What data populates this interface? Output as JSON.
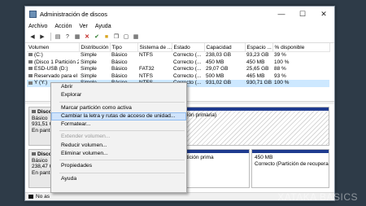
{
  "window": {
    "title": "Administración de discos",
    "min": "—",
    "max": "☐",
    "close": "✕"
  },
  "menu": [
    "Archivo",
    "Acción",
    "Ver",
    "Ayuda"
  ],
  "toolbar_icons": [
    "back-arrow-icon",
    "forward-arrow-icon",
    "list-view-icon",
    "help-icon",
    "properties-icon",
    "delete-icon",
    "check-icon",
    "folder-icon",
    "copy-icon",
    "new-icon",
    "grid-view-icon"
  ],
  "table": {
    "headers": [
      "Volumen",
      "Distribución",
      "Tipo",
      "Sistema de ...",
      "Estado",
      "Capacidad",
      "Espacio ...",
      "% disponible"
    ],
    "rows": [
      [
        "(C:)",
        "Simple",
        "Básico",
        "NTFS",
        "Correcto (...",
        "238,03 GB",
        "93,23 GB",
        "39 %"
      ],
      [
        "(Disco 1 Partición 2)",
        "Simple",
        "Básico",
        "",
        "Correcto (...",
        "450 MB",
        "450 MB",
        "100 %"
      ],
      [
        "ESD-USB (D:)",
        "Simple",
        "Básico",
        "FAT32",
        "Correcto (...",
        "29,07 GB",
        "25,65 GB",
        "88 %"
      ],
      [
        "Reservado para el ...",
        "Simple",
        "Básico",
        "NTFS",
        "Correcto (...",
        "500 MB",
        "465 MB",
        "93 %"
      ],
      [
        "Y (Y:)",
        "Simple",
        "Básico",
        "NTFS",
        "Correcto (...",
        "931,02 GB",
        "930,71 GB",
        "100 %"
      ]
    ]
  },
  "disks": [
    {
      "name": "Disco",
      "type": "Básico",
      "size": "931,51 C",
      "status": "En pant",
      "partitions": [
        {
          "line1": "",
          "line2": "ión primaria)"
        }
      ]
    },
    {
      "name": "Disco",
      "type": "Básico",
      "size": "238,47 C",
      "status": "En pant",
      "partitions": [
        {
          "line1": "",
          "line2": ""
        },
        {
          "line1": "",
          "line2": "o, Partición prima"
        },
        {
          "line1": "450 MB",
          "line2": "Correcto (Partición de recuperac"
        }
      ]
    }
  ],
  "legend": {
    "label": "No as"
  },
  "context_menu": [
    {
      "label": "Abrir",
      "state": "normal"
    },
    {
      "label": "Explorar",
      "state": "normal"
    },
    {
      "sep": true
    },
    {
      "label": "Marcar partición como activa",
      "state": "normal"
    },
    {
      "label": "Cambiar la letra y rutas de acceso de unidad...",
      "state": "highlighted"
    },
    {
      "label": "Formatear...",
      "state": "normal"
    },
    {
      "sep": true
    },
    {
      "label": "Extender volumen...",
      "state": "disabled"
    },
    {
      "label": "Reducir volumen...",
      "state": "normal"
    },
    {
      "label": "Eliminar volumen...",
      "state": "normal"
    },
    {
      "sep": true
    },
    {
      "label": "Propiedades",
      "state": "normal"
    },
    {
      "sep": true
    },
    {
      "label": "Ayuda",
      "state": "normal"
    }
  ],
  "watermark": "XATAKA BASICS"
}
